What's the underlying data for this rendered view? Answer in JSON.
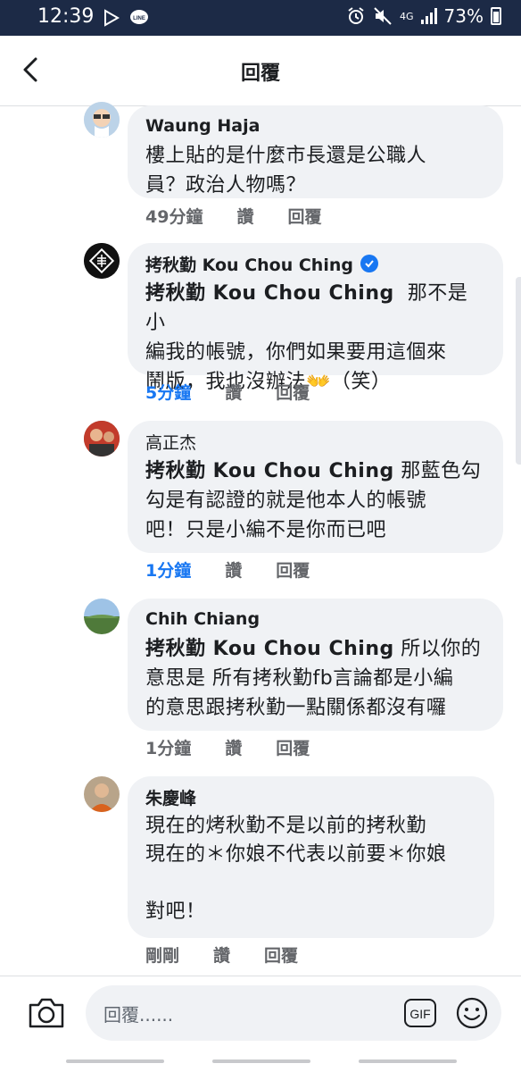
{
  "status_bar": {
    "time": "12:39",
    "network": "4G",
    "battery": "73%"
  },
  "header": {
    "title": "回覆"
  },
  "comments": [
    {
      "author": "Waung Haja",
      "verified": false,
      "tag": "",
      "text": "樓上貼的是什麼市長還是公職人\n員？政治人物嗎？",
      "time": "49分鐘",
      "like": "讚",
      "reply": "回覆",
      "time_highlight": false
    },
    {
      "author": "拷秋勤 Kou Chou Ching",
      "verified": true,
      "tag": "拷秋勤 Kou Chou Ching",
      "text": "  那不是小\n編我的帳號，你們如果要用這個來\n鬧版，我也沒辦法👐（笑）",
      "time": "5分鐘",
      "like": "讚",
      "reply": "回覆",
      "time_highlight": true
    },
    {
      "author": "高正杰",
      "verified": false,
      "tag": "拷秋勤 Kou Chou Ching",
      "text": " 那藍色勾\n勾是有認證的就是他本人的帳號\n吧！只是小編不是你而已吧",
      "time": "1分鐘",
      "like": "讚",
      "reply": "回覆",
      "time_highlight": true
    },
    {
      "author": "Chih Chiang",
      "verified": false,
      "tag": "拷秋勤 Kou Chou Ching",
      "text": " 所以你的\n意思是 所有拷秋勤fb言論都是小編\n的意思跟拷秋勤一點關係都沒有囉",
      "time": "1分鐘",
      "like": "讚",
      "reply": "回覆",
      "time_highlight": false
    },
    {
      "author": "朱慶峰",
      "verified": false,
      "tag": "",
      "text": "現在的烤秋勤不是以前的拷秋勤\n現在的＊你娘不代表以前要＊你娘\n\n對吧！",
      "time": "剛剛",
      "like": "讚",
      "reply": "回覆",
      "time_highlight": false
    }
  ],
  "composer": {
    "placeholder": "回覆......",
    "gif_label": "GIF"
  },
  "colors": {
    "accent": "#1877f2",
    "bubble": "#f0f2f5",
    "status_bar": "#1c2a46"
  }
}
